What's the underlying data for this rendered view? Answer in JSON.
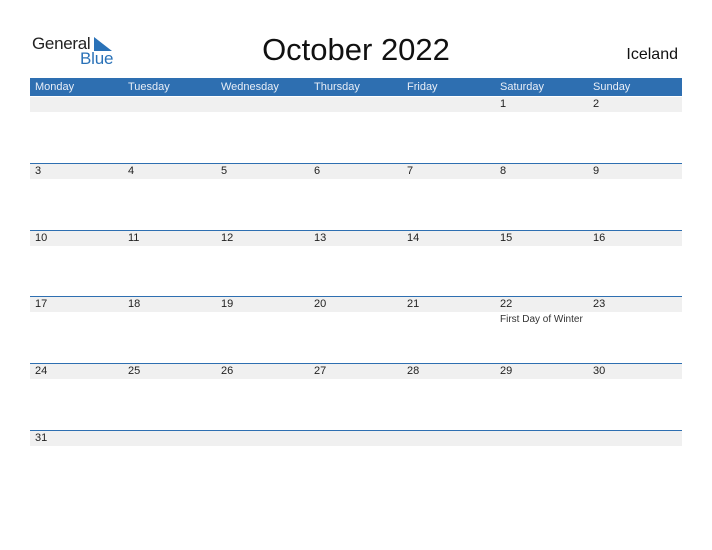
{
  "logo": {
    "general": "General",
    "blue": "Blue"
  },
  "title": "October 2022",
  "country": "Iceland",
  "colors": {
    "accent": "#2e6fb1",
    "band": "#f0f0f0",
    "logo_blue": "#2a72b8"
  },
  "weekdays": [
    "Monday",
    "Tuesday",
    "Wednesday",
    "Thursday",
    "Friday",
    "Saturday",
    "Sunday"
  ],
  "weeks": [
    {
      "days": [
        "",
        "",
        "",
        "",
        "",
        "1",
        "2"
      ],
      "events": [
        "",
        "",
        "",
        "",
        "",
        "",
        ""
      ]
    },
    {
      "days": [
        "3",
        "4",
        "5",
        "6",
        "7",
        "8",
        "9"
      ],
      "events": [
        "",
        "",
        "",
        "",
        "",
        "",
        ""
      ]
    },
    {
      "days": [
        "10",
        "11",
        "12",
        "13",
        "14",
        "15",
        "16"
      ],
      "events": [
        "",
        "",
        "",
        "",
        "",
        "",
        ""
      ]
    },
    {
      "days": [
        "17",
        "18",
        "19",
        "20",
        "21",
        "22",
        "23"
      ],
      "events": [
        "",
        "",
        "",
        "",
        "",
        "First Day of Winter",
        ""
      ]
    },
    {
      "days": [
        "24",
        "25",
        "26",
        "27",
        "28",
        "29",
        "30"
      ],
      "events": [
        "",
        "",
        "",
        "",
        "",
        "",
        ""
      ]
    },
    {
      "days": [
        "31",
        "",
        "",
        "",
        "",
        "",
        ""
      ],
      "events": [
        "",
        "",
        "",
        "",
        "",
        "",
        ""
      ]
    }
  ]
}
